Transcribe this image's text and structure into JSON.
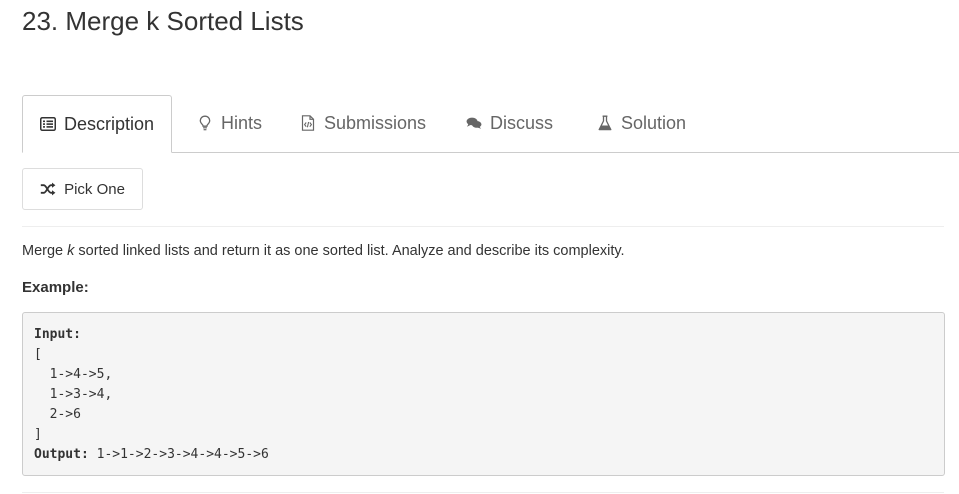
{
  "problem": {
    "title": "23. Merge k Sorted Lists"
  },
  "tabs": [
    {
      "label": "Description",
      "icon": "list-alt-icon",
      "active": true
    },
    {
      "label": "Hints",
      "icon": "lightbulb-icon",
      "active": false
    },
    {
      "label": "Submissions",
      "icon": "code-file-icon",
      "active": false
    },
    {
      "label": "Discuss",
      "icon": "comments-icon",
      "active": false
    },
    {
      "label": "Solution",
      "icon": "flask-icon",
      "active": false
    }
  ],
  "pick_one": {
    "label": "Pick One",
    "icon": "shuffle-icon"
  },
  "description": {
    "before": "Merge ",
    "emph": "k",
    "after": " sorted linked lists and return it as one sorted list. Analyze and describe its complexity."
  },
  "example": {
    "label": "Example:",
    "input_label": "Input:",
    "input_lines": [
      "[",
      "  1->4->5,",
      "  1->3->4,",
      "  2->6",
      "]"
    ],
    "output_label": "Output:",
    "output_value": " 1->1->2->3->4->4->5->6"
  },
  "colors": {
    "text": "#333333",
    "muted": "#666666",
    "border": "#cccccc",
    "code_bg": "#f5f5f5"
  }
}
